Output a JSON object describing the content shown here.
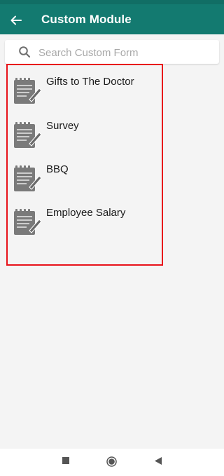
{
  "header": {
    "title": "Custom Module",
    "back_icon": "arrow-left-icon"
  },
  "search": {
    "placeholder": "Search Custom Form",
    "value": "",
    "icon": "search-icon"
  },
  "forms": [
    {
      "label": "Gifts to The Doctor",
      "icon": "form-document-icon"
    },
    {
      "label": "Survey",
      "icon": "form-document-icon"
    },
    {
      "label": "BBQ",
      "icon": "form-document-icon"
    },
    {
      "label": "Employee Salary",
      "icon": "form-document-icon"
    }
  ],
  "navigation": {
    "buttons": [
      "recent-apps-icon",
      "home-icon",
      "back-icon"
    ]
  },
  "colors": {
    "appbar": "#137a70",
    "highlight": "#e8121a",
    "background": "#f4f4f4",
    "icon": "#7a7a7a"
  }
}
